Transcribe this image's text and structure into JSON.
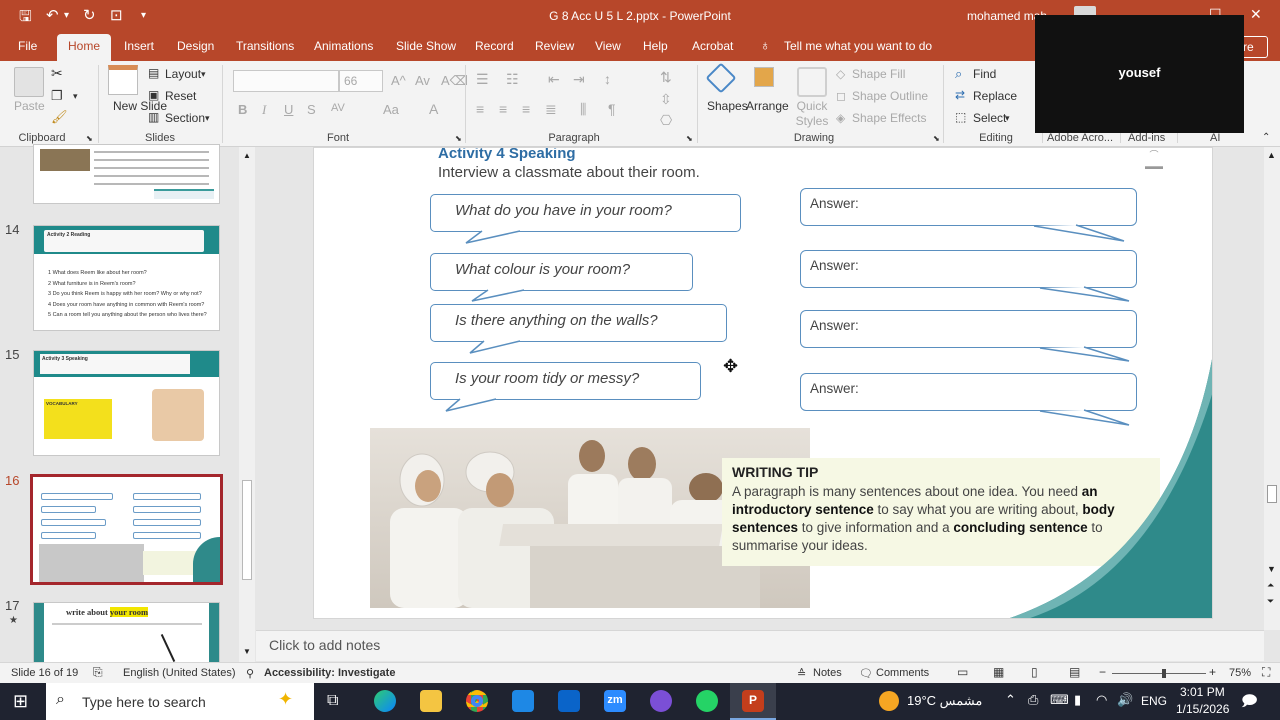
{
  "window": {
    "title": "G 8 Acc U 5 L 2.pptx  -  PowerPoint",
    "user": "mohamed mah",
    "controls": {
      "minimize": "—",
      "maximize": "☐",
      "close": "✕"
    }
  },
  "quick_access": {
    "save": "🖫",
    "undo": "↶",
    "redo": "↻",
    "present": "⊡",
    "customize": "▾"
  },
  "tabs": [
    "File",
    "Home",
    "Insert",
    "Design",
    "Transitions",
    "Animations",
    "Slide Show",
    "Record",
    "Review",
    "View",
    "Help",
    "Acrobat"
  ],
  "tell_me": "Tell me what you want to do",
  "share_label": "re",
  "ribbon": {
    "clipboard": {
      "paste": "Paste",
      "label": "Clipboard"
    },
    "slides": {
      "new_slide": "New Slide",
      "layout": "Layout",
      "reset": "Reset",
      "section": "Section",
      "label": "Slides"
    },
    "font": {
      "size": "66",
      "label": "Font",
      "bold": "B",
      "italic": "I",
      "underline": "U",
      "strike": "S",
      "spacing": "AV",
      "case": "Aa",
      "color": "A",
      "grow": "A^",
      "shrink": "Av",
      "clear": "A⌫"
    },
    "paragraph": {
      "label": "Paragraph"
    },
    "drawing": {
      "shapes": "Shapes",
      "arrange": "Arrange",
      "quick_styles": "Quick Styles",
      "shape_fill": "Shape Fill",
      "shape_outline": "Shape Outline",
      "shape_effects": "Shape Effects",
      "label": "Drawing"
    },
    "editing": {
      "find": "Find",
      "replace": "Replace",
      "select": "Select",
      "label": "Editing"
    },
    "adobe": "Adobe Acro...",
    "addins": "Add-ins",
    "ai": "AI"
  },
  "overlay": {
    "name": "yousef"
  },
  "slide_numbers": [
    "14",
    "15",
    "16",
    "17"
  ],
  "slide17_star": "★",
  "thumb14": {
    "title": "Activity 2 Reading",
    "lines": [
      "1 What does Reem like about her room?",
      "2 What furniture is in Reem's room?",
      "3 Do you think Reem is happy with her room? Why or why not?",
      "4 Does your room have anything in common with Reem's room?",
      "5 Can a room tell you anything about the person who lives there?"
    ]
  },
  "thumb15": {
    "title": "Activity 3 Speaking",
    "vocab": "VOCABULARY"
  },
  "thumb17": {
    "title_a": "write about ",
    "title_b": "your room"
  },
  "slide": {
    "heading": "Activity 4 Speaking",
    "subheading": "Interview a classmate about their room.",
    "questions": [
      "What do you have in your room?",
      "What colour is your room?",
      "Is there anything on the walls?",
      "Is your room tidy or messy?"
    ],
    "answer_label": "Answer:",
    "tip_title": "WRITING TIP",
    "tip": {
      "t1": "A paragraph is many sentences about one idea. You need ",
      "b1": "an introductory sentence",
      "t2": " to say what you are writing about, ",
      "b2": "body sentences",
      "t3": " to give information and a ",
      "b3": "concluding sentence",
      "t4": " to summarise your ideas."
    }
  },
  "notes_placeholder": "Click to add notes",
  "status": {
    "slide_count": "Slide 16 of 19",
    "language": "English (United States)",
    "accessibility": "Accessibility: Investigate",
    "notes": "Notes",
    "comments": "Comments",
    "zoom": "75%",
    "zoom_level": 0.55
  },
  "taskbar": {
    "search_placeholder": "Type here to search",
    "weather": "19°C  مشمس",
    "lang": "ENG",
    "time": "3:01 PM",
    "date": "1/15/2026",
    "zoom_app": "zm"
  }
}
